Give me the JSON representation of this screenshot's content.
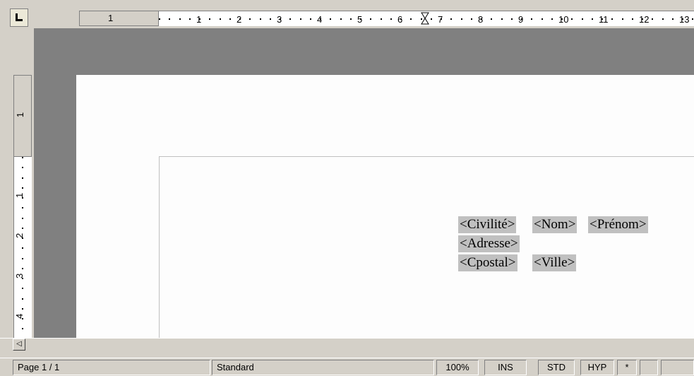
{
  "ruler": {
    "horizontal_labels": [
      "1",
      "1",
      "2",
      "3",
      "4",
      "5",
      "6",
      "7",
      "8",
      "9",
      "10",
      "11",
      "12",
      "13"
    ],
    "vertical_labels": [
      "1",
      "1",
      "2",
      "3",
      "4"
    ]
  },
  "document": {
    "fields": {
      "civilite": "<Civilité>",
      "nom": "<Nom>",
      "prenom": "<Prénom>",
      "adresse": "<Adresse>",
      "cpostal": "<Cpostal>",
      "ville": "<Ville>"
    }
  },
  "scrollbar": {
    "left_arrow": "◁"
  },
  "statusbar": {
    "page": "Page 1 / 1",
    "style": "Standard",
    "zoom": "100%",
    "insert_mode": "INS",
    "selection_mode": "STD",
    "hyperlink_mode": "HYP",
    "modified": "*",
    "extra1": "",
    "extra2": ""
  },
  "colors": {
    "chrome": "#d4d0c8",
    "workspace": "#808080",
    "page": "#fdfdfd",
    "field_shading": "#c0c0c0"
  },
  "icons": {
    "tab_selector": "left-tab-icon",
    "scroll_left": "scroll-left-arrow-icon"
  }
}
